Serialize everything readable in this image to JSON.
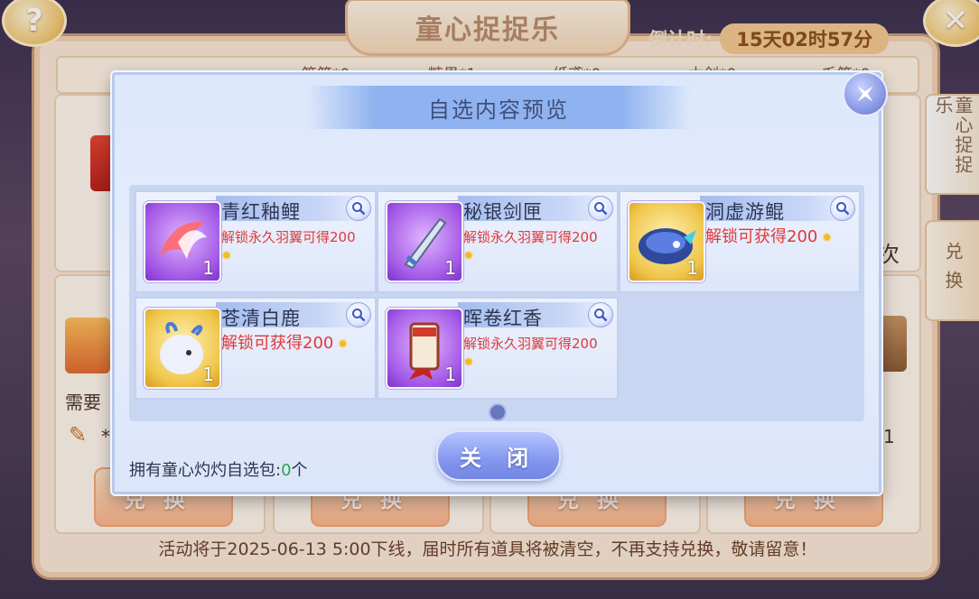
{
  "game": {
    "title": "童心捉捉乐",
    "countdown_label": "倒计时:",
    "countdown_value": "15天02时57分",
    "help_glyph": "?",
    "close_glyph": "✕",
    "currency": [
      "笔简*0",
      "糖果*1",
      "纸鸢*0",
      "木剑*0",
      "毛笔*0"
    ],
    "side_tabs": [
      {
        "label": "童心捉捉乐",
        "active": true
      },
      {
        "label": "兑换",
        "active": false
      }
    ],
    "partial_texts": {
      "times": "次",
      "need": "需要",
      "cost_left": "*",
      "cost_right": "*1"
    },
    "exchange_buttons": [
      "兑换",
      "兑换",
      "兑换",
      "兑换"
    ],
    "notice": "活动将于2025-06-13 5:00下线，届时所有道具将被清空，不再支持兑换，敬请留意！"
  },
  "modal": {
    "title": "自选内容预览",
    "close_button": "关 闭",
    "owned_prefix": "拥有童心灼灼自选包:",
    "owned_count": "0",
    "owned_suffix": "个",
    "items": [
      {
        "name": "青红釉鲤",
        "desc": "解锁永久羽翼可得200",
        "count": "1",
        "icon": "phoenix-wing-icon",
        "rarity": "purple"
      },
      {
        "name": "秘银剑匣",
        "desc": "解锁永久羽翼可得200",
        "count": "1",
        "icon": "silver-sword-icon",
        "rarity": "purple"
      },
      {
        "name": "洞虚游鲲",
        "desc": "解锁可获得200",
        "count": "1",
        "icon": "blue-kun-fish-icon",
        "rarity": "gold"
      },
      {
        "name": "苍清白鹿",
        "desc": "解锁可获得200",
        "count": "1",
        "icon": "white-deer-icon",
        "rarity": "gold"
      },
      {
        "name": "晖卷红香",
        "desc": "解锁永久羽翼可得200",
        "count": "1",
        "icon": "red-scroll-icon",
        "rarity": "purple"
      }
    ]
  },
  "colors": {
    "modal_bg": "#e7eefc",
    "desc_red": "#e0393a",
    "owned_green": "#22a84a",
    "button_blue": "#8397ef"
  }
}
